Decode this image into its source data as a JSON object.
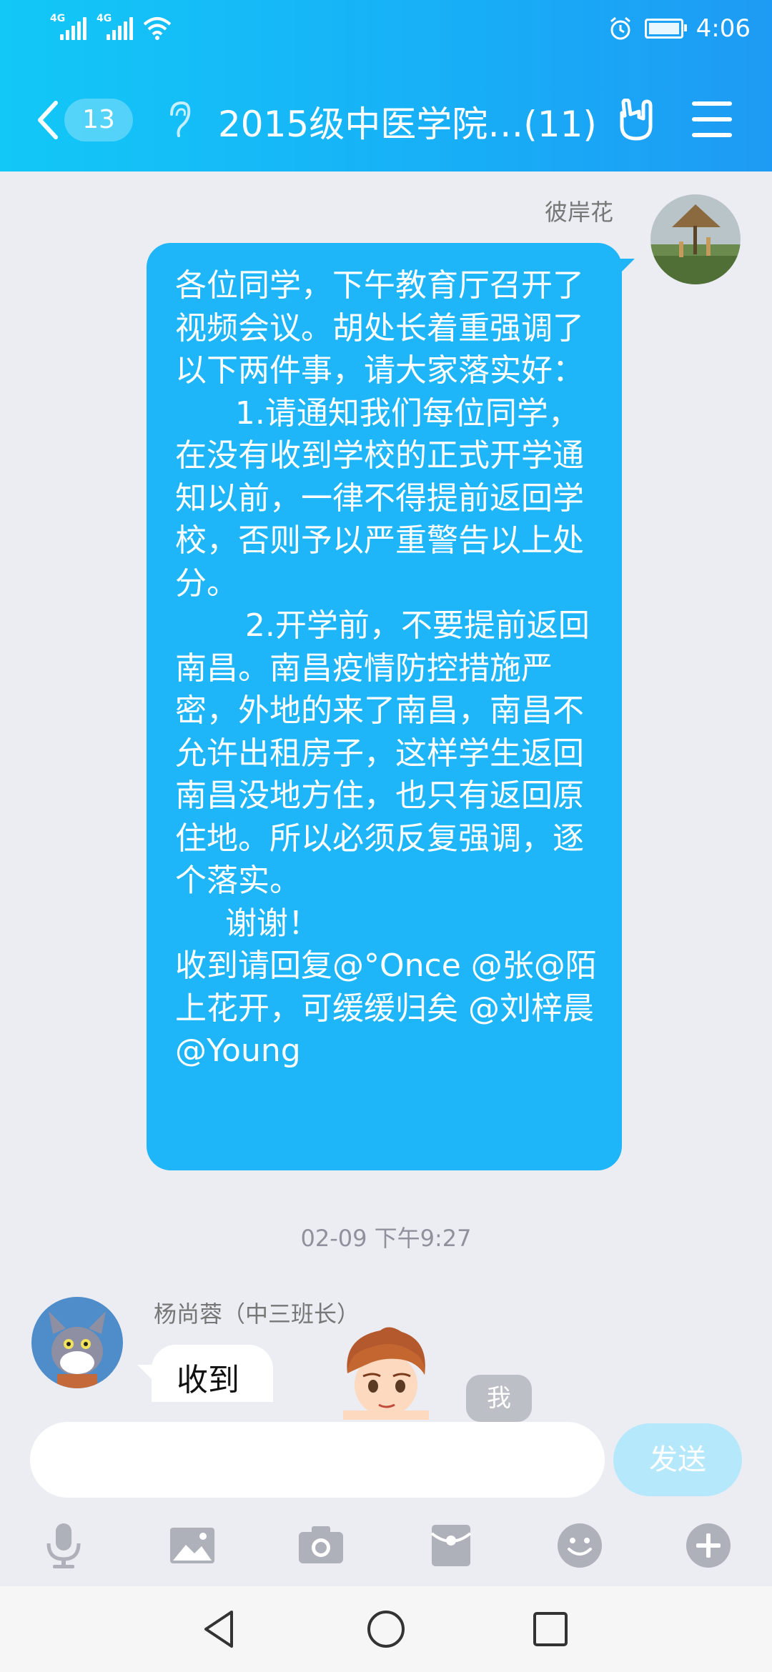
{
  "status_bar": {
    "network_1": "4G",
    "network_2": "4G",
    "time": "4:06"
  },
  "nav": {
    "unread_count": "13",
    "chat_title": "2015级中医学院…(11)"
  },
  "message": {
    "sender": "彼岸花",
    "text": "各位同学，下午教育厅召开了视频会议。胡处长着重强调了以下两件事，请大家落实好：\n      1.请通知我们每位同学，在没有收到学校的正式开学通知以前，一律不得提前返回学校，否则予以严重警告以上处分。\n       2.开学前，不要提前返回南昌。南昌疫情防控措施严密，外地的来了南昌，南昌不允许出租房子，这样学生返回南昌没地方住，也只有返回原住地。所以必须反复强调，逐个落实。\n     谢谢！\n收到请回复@°Once @张@陌上花开，可缓缓归矣 @刘梓晨 @Young"
  },
  "timestamp": "02-09 下午9:27",
  "reply": {
    "sender": "杨尚蓉（中三班长）",
    "text": "收到",
    "me_tag": "我"
  },
  "composer": {
    "placeholder": "",
    "send_label": "发送"
  },
  "colors": {
    "header_start": "#12C8F7",
    "header_end": "#1E9BF4",
    "bubble": "#1EB6F8",
    "send_disabled": "#B6E8FB",
    "icon_gray": "#AEB1BA"
  },
  "icons": [
    "back-chevron-icon",
    "ear-icon",
    "gesture-hand-icon",
    "menu-icon",
    "microphone-icon",
    "image-icon",
    "camera-icon",
    "red-packet-icon",
    "emoji-icon",
    "plus-icon",
    "nav-back-icon",
    "nav-home-icon",
    "nav-recents-icon"
  ]
}
